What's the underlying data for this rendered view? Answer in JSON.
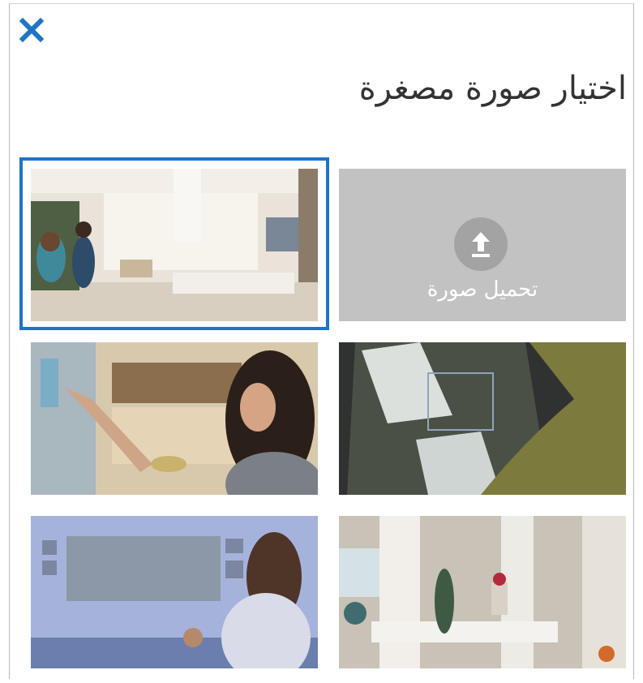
{
  "dialog": {
    "title": "اختيار صورة مصغرة",
    "close_icon": "close-icon",
    "accent_color": "#1f74c6"
  },
  "upload": {
    "label": "تحميل صورة",
    "icon": "upload-icon",
    "background": "#c2c2c2"
  },
  "thumbnails": [
    {
      "scene": "living-room-children",
      "selected": true
    },
    {
      "scene": "woman-touch-wall"
    },
    {
      "scene": "hand-on-screen"
    },
    {
      "scene": "girl-watching-wall"
    },
    {
      "scene": "shelf-figurines"
    }
  ]
}
